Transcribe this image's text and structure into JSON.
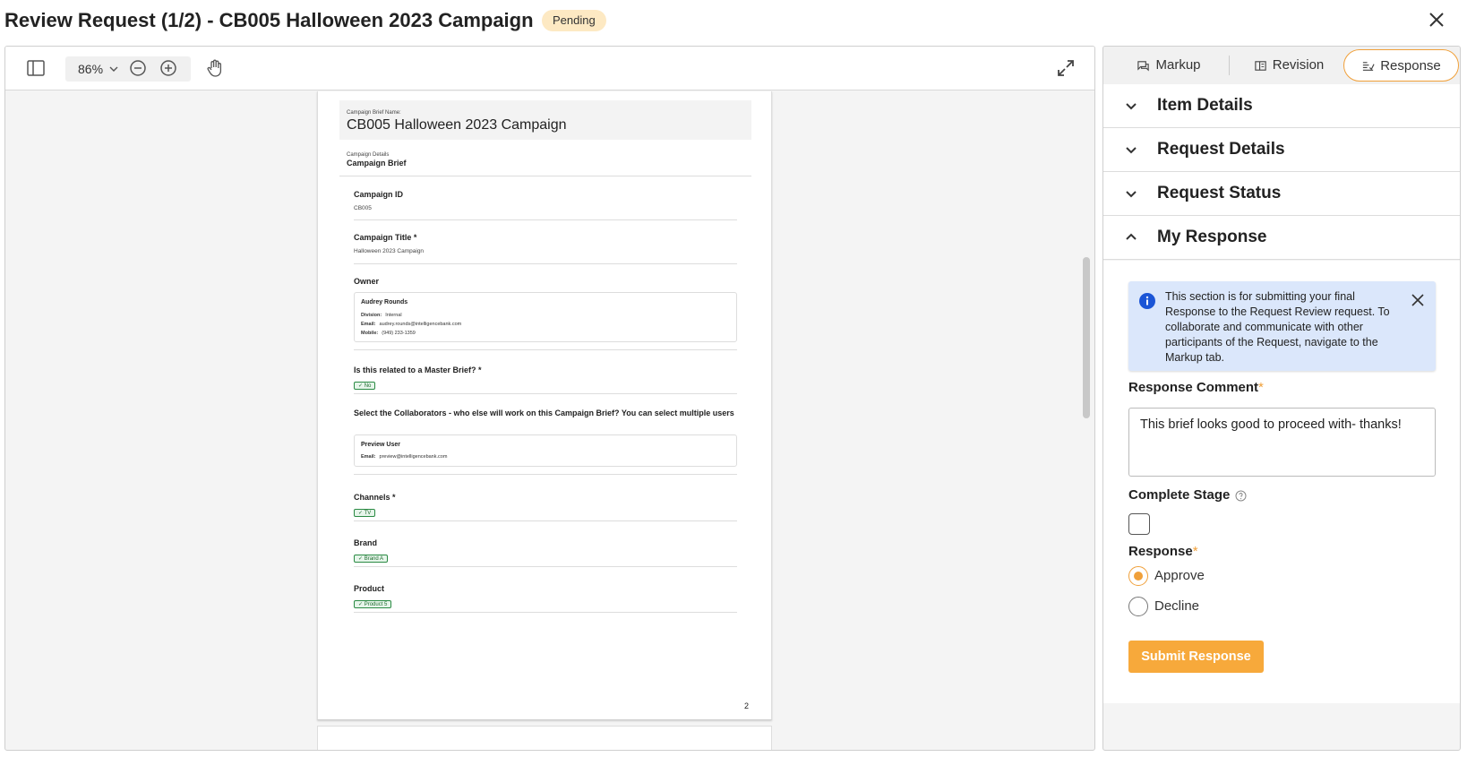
{
  "header": {
    "title": "Review Request (1/2) - CB005 Halloween 2023 Campaign",
    "status_badge": "Pending"
  },
  "viewer": {
    "zoom": "86%",
    "icons": [
      "sidebar-toggle-icon",
      "zoom-out-icon",
      "zoom-in-icon",
      "hand-pan-icon",
      "expand-icon"
    ],
    "document": {
      "brief_name_label": "Campaign Brief Name:",
      "brief_name": "CB005 Halloween 2023 Campaign",
      "details_label": "Campaign Details",
      "details_title": "Campaign Brief",
      "fields": {
        "campaign_id_label": "Campaign ID",
        "campaign_id": "CB005",
        "campaign_title_label": "Campaign Title *",
        "campaign_title": "Halloween 2023 Campaign",
        "owner_label": "Owner",
        "owner": {
          "name": "Audrey Rounds",
          "division_label": "Division:",
          "division": "Internal",
          "email_label": "Email:",
          "email": "audrey.rounds@intelligencebank.com",
          "mobile_label": "Mobile:",
          "mobile": "(949) 233-1359"
        },
        "master_brief_label": "Is this related to a Master Brief? *",
        "master_brief": "✓ No",
        "collaborators_label": "Select the Collaborators - who else will work on this Campaign Brief? You can select multiple users",
        "collaborator": {
          "name": "Preview User",
          "email_label": "Email:",
          "email": "preview@intelligencebank.com"
        },
        "channels_label": "Channels *",
        "channels": "✓ TV",
        "brand_label": "Brand",
        "brand": "✓ Brand A",
        "product_label": "Product",
        "product": "✓ Product 5"
      },
      "page_number": "2"
    }
  },
  "panel": {
    "tabs": [
      {
        "label": "Markup",
        "icon": "comments-icon"
      },
      {
        "label": "Revision",
        "icon": "revision-icon"
      },
      {
        "label": "Response",
        "icon": "response-icon",
        "active": true
      }
    ],
    "sections": [
      {
        "label": "Item Details",
        "expanded": false
      },
      {
        "label": "Request Details",
        "expanded": false
      },
      {
        "label": "Request Status",
        "expanded": false
      },
      {
        "label": "My Response",
        "expanded": true
      }
    ],
    "info_message": "This section is for submitting your final Response to the Request Review request. To collaborate and communicate with other participants of the Request, navigate to the Markup tab.",
    "response_comment_label": "Response Comment",
    "response_comment_value": "This brief looks good to proceed with- thanks!",
    "complete_stage_label": "Complete Stage",
    "complete_stage_checked": false,
    "response_label": "Response",
    "response_options": [
      "Approve",
      "Decline"
    ],
    "response_selected": "Approve",
    "submit_label": "Submit Response",
    "required_mark": "*",
    "accent_color": "#f0a03a"
  }
}
